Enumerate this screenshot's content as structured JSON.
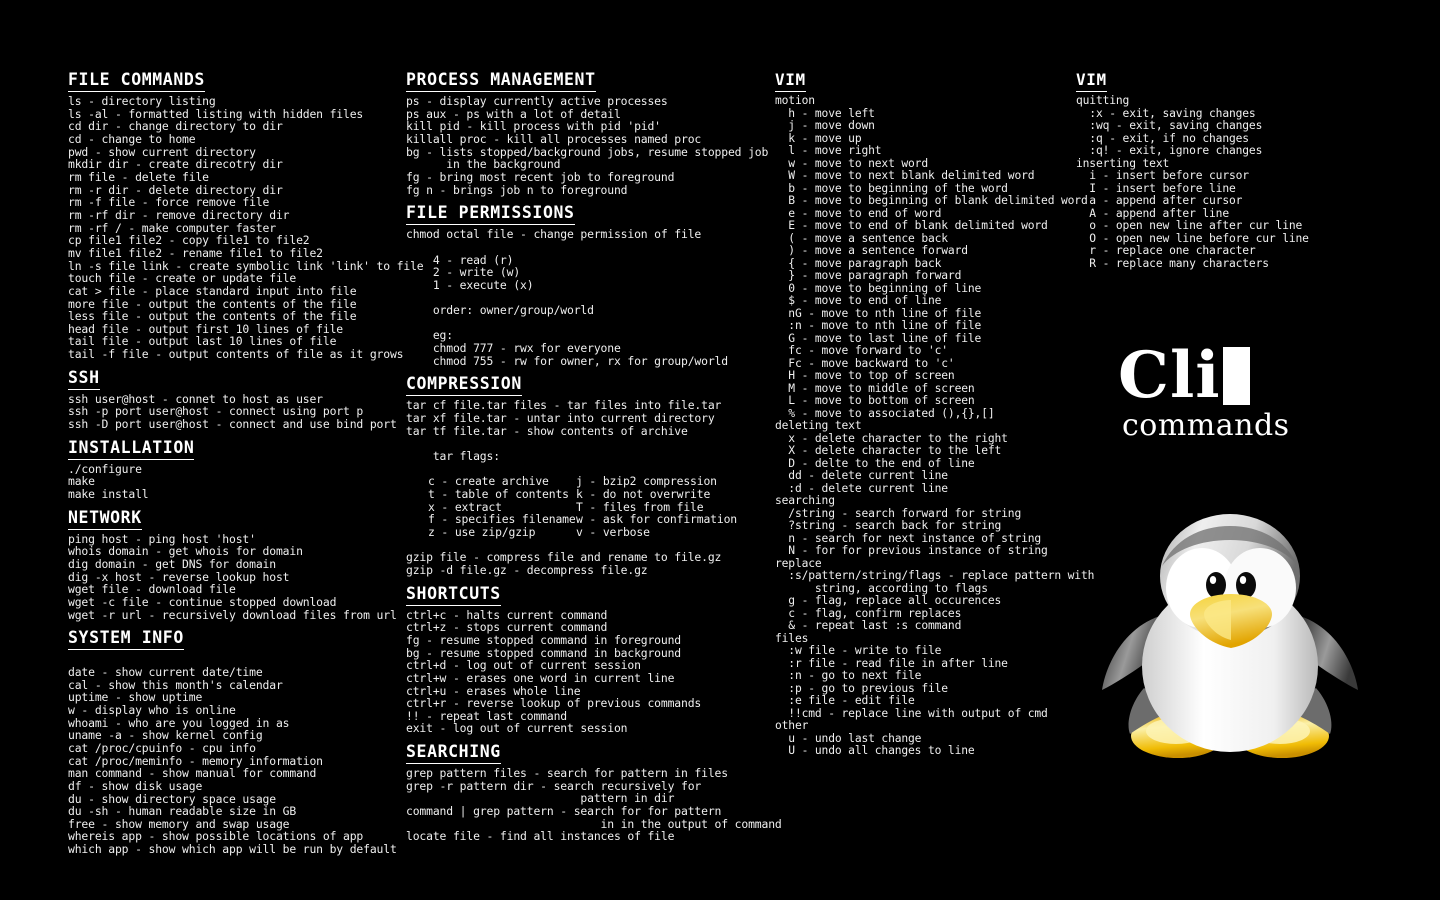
{
  "meta": {
    "background_color": "#000000",
    "text_color": "#efefef",
    "accent_color": "#ffffff"
  },
  "logo": {
    "title": "Cli",
    "subtitle": "commands",
    "cursor": "block-cursor"
  },
  "mascot": {
    "name": "tux-penguin",
    "body_color": "#ffffff",
    "shade_color": "#b8b8b8",
    "beak_color": "#f2c000",
    "foot_color": "#f5c400",
    "eye_color": "#000000"
  },
  "columns": [
    {
      "id": "col-1",
      "sections": [
        {
          "title": "FILE COMMANDS",
          "lines": [
            "ls - directory listing",
            "ls -al - formatted listing with hidden files",
            "cd dir - change directory to dir",
            "cd - change to home",
            "pwd - show current directory",
            "mkdir dir - create direcotry dir",
            "rm file - delete file",
            "rm -r dir - delete directory dir",
            "rm -f file - force remove file",
            "rm -rf dir - remove directory dir",
            "rm -rf / - make computer faster",
            "cp file1 file2 - copy file1 to file2",
            "mv file1 file2 - rename file1 to file2",
            "ln -s file link - create symbolic link 'link' to file",
            "touch file - create or update file",
            "cat > file - place standard input into file",
            "more file - output the contents of the file",
            "less file - output the contents of the file",
            "head file - output first 10 lines of file",
            "tail file - output last 10 lines of file",
            "tail -f file - output contents of file as it grows"
          ]
        },
        {
          "title": "SSH",
          "lines": [
            "ssh user@host - connet to host as user",
            "ssh -p port user@host - connect using port p",
            "ssh -D port user@host - connect and use bind port"
          ]
        },
        {
          "title": "INSTALLATION",
          "lines": [
            "./configure",
            "make",
            "make install"
          ]
        },
        {
          "title": "NETWORK",
          "lines": [
            "ping host - ping host 'host'",
            "whois domain - get whois for domain",
            "dig domain - get DNS for domain",
            "dig -x host - reverse lookup host",
            "wget file - download file",
            "wget -c file - continue stopped download",
            "wget -r url - recursively download files from url"
          ]
        },
        {
          "title": "SYSTEM INFO",
          "lines": [
            "",
            "date - show current date/time",
            "cal - show this month's calendar",
            "uptime - show uptime",
            "w - display who is online",
            "whoami - who are you logged in as",
            "uname -a - show kernel config",
            "cat /proc/cpuinfo - cpu info",
            "cat /proc/meminfo - memory information",
            "man command - show manual for command",
            "df - show disk usage",
            "du - show directory space usage",
            "du -sh - human readable size in GB",
            "free - show memory and swap usage",
            "whereis app - show possible locations of app",
            "which app - show which app will be run by default"
          ]
        }
      ]
    },
    {
      "id": "col-2",
      "sections": [
        {
          "title": "PROCESS MANAGEMENT",
          "lines": [
            "ps - display currently active processes",
            "ps aux - ps with a lot of detail",
            "kill pid - kill process with pid 'pid'",
            "killall proc - kill all processes named proc",
            "bg - lists stopped/background jobs, resume stopped job",
            "      in the background",
            "fg - bring most recent job to foreground",
            "fg n - brings job n to foreground"
          ]
        },
        {
          "title": "FILE PERMISSIONS",
          "lines": [
            "chmod octal file - change permission of file",
            "",
            "    4 - read (r)",
            "    2 - write (w)",
            "    1 - execute (x)",
            "",
            "    order: owner/group/world",
            "",
            "    eg:",
            "    chmod 777 - rwx for everyone",
            "    chmod 755 - rw for owner, rx for group/world"
          ]
        },
        {
          "title": "COMPRESSION",
          "lines": [
            "tar cf file.tar files - tar files into file.tar",
            "tar xf file.tar - untar into current directory",
            "tar tf file.tar - show contents of archive",
            "",
            "    tar flags:",
            ""
          ],
          "flag_table": {
            "left": [
              "c - create archive",
              "t - table of contents",
              "x - extract",
              "f - specifies filename",
              "z - use zip/gzip"
            ],
            "right": [
              "j - bzip2 compression",
              "k - do not overwrite",
              "T - files from file",
              "w - ask for confirmation",
              "v - verbose"
            ]
          },
          "lines_after": [
            "",
            "gzip file - compress file and rename to file.gz",
            "gzip -d file.gz - decompress file.gz"
          ]
        },
        {
          "title": "SHORTCUTS",
          "lines": [
            "ctrl+c - halts current command",
            "ctrl+z - stops current command",
            "fg - resume stopped command in foreground",
            "bg - resume stopped command in background",
            "ctrl+d - log out of current session",
            "ctrl+w - erases one word in current line",
            "ctrl+u - erases whole line",
            "ctrl+r - reverse lookup of previous commands",
            "!! - repeat last command",
            "exit - log out of current session"
          ]
        },
        {
          "title": "SEARCHING",
          "lines": [
            "grep pattern files - search for pattern in files",
            "grep -r pattern dir - search recursively for",
            "                          pattern in dir",
            "command | grep pattern - search for for pattern",
            "                             in in the output of command",
            "locate file - find all instances of file"
          ]
        }
      ]
    },
    {
      "id": "col-3",
      "sections": [
        {
          "title": "VIM",
          "groups": [
            {
              "label": "motion",
              "lines": [
                "  h - move left",
                "  j - move down",
                "  k - move up",
                "  l - move right",
                "  w - move to next word",
                "  W - move to next blank delimited word",
                "  b - move to beginning of the word",
                "  B - move to beginning of blank delimited word",
                "  e - move to end of word",
                "  E - move to end of blank delimited word",
                "  ( - move a sentence back",
                "  ) - move a sentence forward",
                "  { - move paragraph back",
                "  } - move paragraph forward",
                "  0 - move to beginning of line",
                "  $ - move to end of line",
                "  nG - move to nth line of file",
                "  :n - move to nth line of file",
                "  G - move to last line of file",
                "  fc - move forward to 'c'",
                "  Fc - move backward to 'c'",
                "  H - move to top of screen",
                "  M - move to middle of screen",
                "  L - move to bottom of screen",
                "  % - move to associated (),{},[]"
              ]
            },
            {
              "label": "deleting text",
              "lines": [
                "  x - delete character to the right",
                "  X - delete character to the left",
                "  D - delte to the end of line",
                "  dd - delete current line",
                "  :d - delete current line"
              ]
            },
            {
              "label": "searching",
              "lines": [
                "  /string - search forward for string",
                "  ?string - search back for string",
                "  n - search for next instance of string",
                "  N - for for previous instance of string"
              ]
            },
            {
              "label": "replace",
              "lines": [
                "  :s/pattern/string/flags - replace pattern with",
                "      string, according to flags",
                "  g - flag, replace all occurences",
                "  c - flag, confirm replaces",
                "  & - repeat last :s command"
              ]
            },
            {
              "label": "files",
              "lines": [
                "  :w file - write to file",
                "  :r file - read file in after line",
                "  :n - go to next file",
                "  :p - go to previous file",
                "  :e file - edit file",
                "  !!cmd - replace line with output of cmd"
              ]
            },
            {
              "label": "other",
              "lines": [
                "  u - undo last change",
                "  U - undo all changes to line"
              ]
            }
          ]
        }
      ]
    },
    {
      "id": "col-4",
      "sections": [
        {
          "title": "VIM",
          "groups": [
            {
              "label": "quitting",
              "lines": [
                "  :x - exit, saving changes",
                "  :wq - exit, saving changes",
                "  :q - exit, if no changes",
                "  :q! - exit, ignore changes"
              ]
            },
            {
              "label": "inserting text",
              "lines": [
                "  i - insert before cursor",
                "  I - insert before line",
                "  a - append after cursor",
                "  A - append after line",
                "  o - open new line after cur line",
                "  O - open new line before cur line",
                "  r - replace one character",
                "  R - replace many characters"
              ]
            }
          ]
        }
      ]
    }
  ]
}
